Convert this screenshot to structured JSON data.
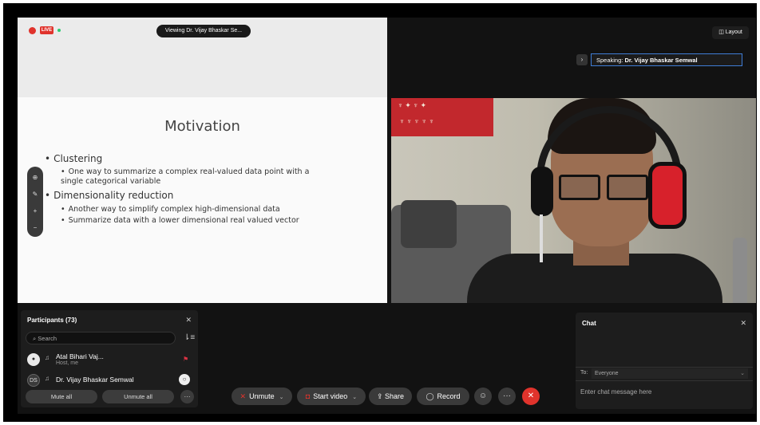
{
  "meeting": {
    "live_badge": "LIVE",
    "viewing_label": "Viewing Dr. Vijay Bhaskar Se..."
  },
  "slide": {
    "title": "Motivation",
    "bullets": [
      {
        "text": "Clustering",
        "sub": [
          "One way to summarize a complex real-valued data point with a single categorical variable"
        ]
      },
      {
        "text": "Dimensionality reduction",
        "sub": [
          "Another way to simplify complex high-dimensional data",
          "Summarize data with a lower dimensional real valued vector"
        ]
      }
    ]
  },
  "zoom_toolbar": [
    "zoom-fit-icon",
    "pointer-icon",
    "zoom-in-icon",
    "zoom-out-icon"
  ],
  "top_right": {
    "layout_label": "Layout",
    "speaking_prefix": "Speaking:",
    "speaking_name": "Dr. Vijay Bhaskar Semwal"
  },
  "participants": {
    "title": "Participants (73)",
    "search_placeholder": "Search",
    "rows": [
      {
        "initials": "",
        "name": "Atal Bihari Vaj...",
        "sub": "Host, me"
      },
      {
        "initials": "DS",
        "name": "Dr. Vijay Bhaskar Semwal",
        "sub": ""
      }
    ],
    "mute_all": "Mute all",
    "unmute_all": "Unmute all"
  },
  "controls": {
    "unmute": "Unmute",
    "start_video": "Start video",
    "share": "Share",
    "record": "Record"
  },
  "chat": {
    "title": "Chat",
    "to_label": "To:",
    "to_value": "Everyone",
    "input_placeholder": "Enter chat message here"
  },
  "colors": {
    "accent_red": "#e0332c",
    "speaking_border": "#3f7dd6",
    "background": "#121212"
  }
}
